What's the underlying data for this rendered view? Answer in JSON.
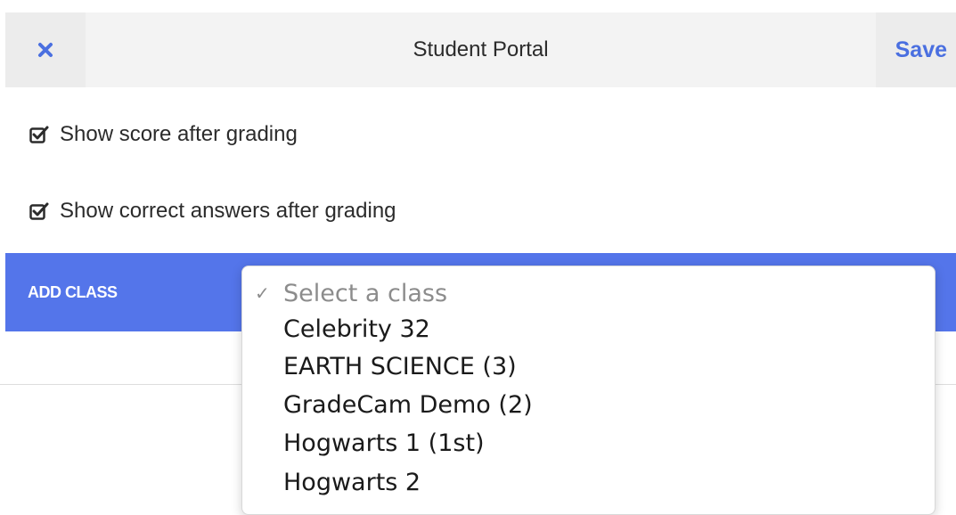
{
  "header": {
    "title": "Student Portal",
    "save_label": "Save",
    "close_icon": "close-icon"
  },
  "options": [
    {
      "label": "Show score after grading",
      "checked": true
    },
    {
      "label": "Show correct answers after grading",
      "checked": true
    }
  ],
  "add_class": {
    "label": "ADD CLASS",
    "bar_color": "#5475ea",
    "select": {
      "selected": "Select a class",
      "options": [
        "Select a class",
        "Celebrity 32",
        "EARTH SCIENCE (3)",
        "GradeCam Demo (2)",
        "Hogwarts 1 (1st)",
        "Hogwarts 2"
      ]
    }
  },
  "colors": {
    "accent": "#4a6fe0",
    "header_bg": "#f3f3f3"
  }
}
